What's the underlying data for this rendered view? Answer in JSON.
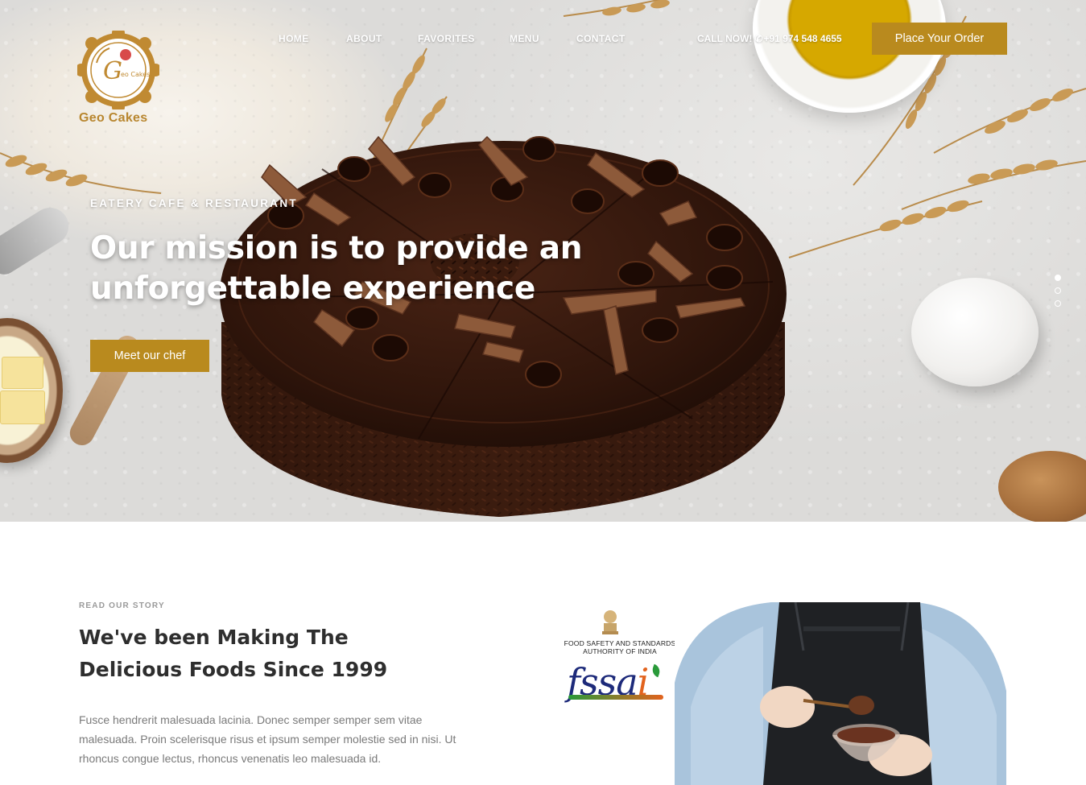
{
  "header": {
    "logo_text": "Geo Cakes",
    "nav": [
      "HOME",
      "ABOUT",
      "FAVORITES",
      "MENU",
      "CONTACT"
    ],
    "call_label": "CALL NOW!",
    "phone": "+91 974 548 4655",
    "order_button": "Place Your Order"
  },
  "hero": {
    "eyebrow": "EATERY CAFE & RESTAURANT",
    "title": "Our mission is to provide an unforgettable experience",
    "cta": "Meet our chef",
    "slides": 3,
    "active_slide": 1
  },
  "story": {
    "eyebrow": "READ OUR STORY",
    "title": "We've been Making The Delicious Foods Since 1999",
    "text": "Fusce hendrerit malesuada lacinia. Donec semper semper sem vitae malesuada. Proin scelerisque risus et ipsum semper molestie sed in nisi. Ut rhoncus congue lectus, rhoncus venenatis leo malesuada id."
  },
  "certification": {
    "caption": "FOOD SAFETY AND STANDARDS AUTHORITY OF INDIA",
    "logo_main": "fssa",
    "logo_end": "i"
  },
  "colors": {
    "accent": "#b98a1e",
    "logo_gold": "#b8862f",
    "heading": "#2e2e2e",
    "body_text": "#7a7a7a"
  },
  "icons": [
    "phone-icon",
    "fssai-emblem-icon"
  ]
}
